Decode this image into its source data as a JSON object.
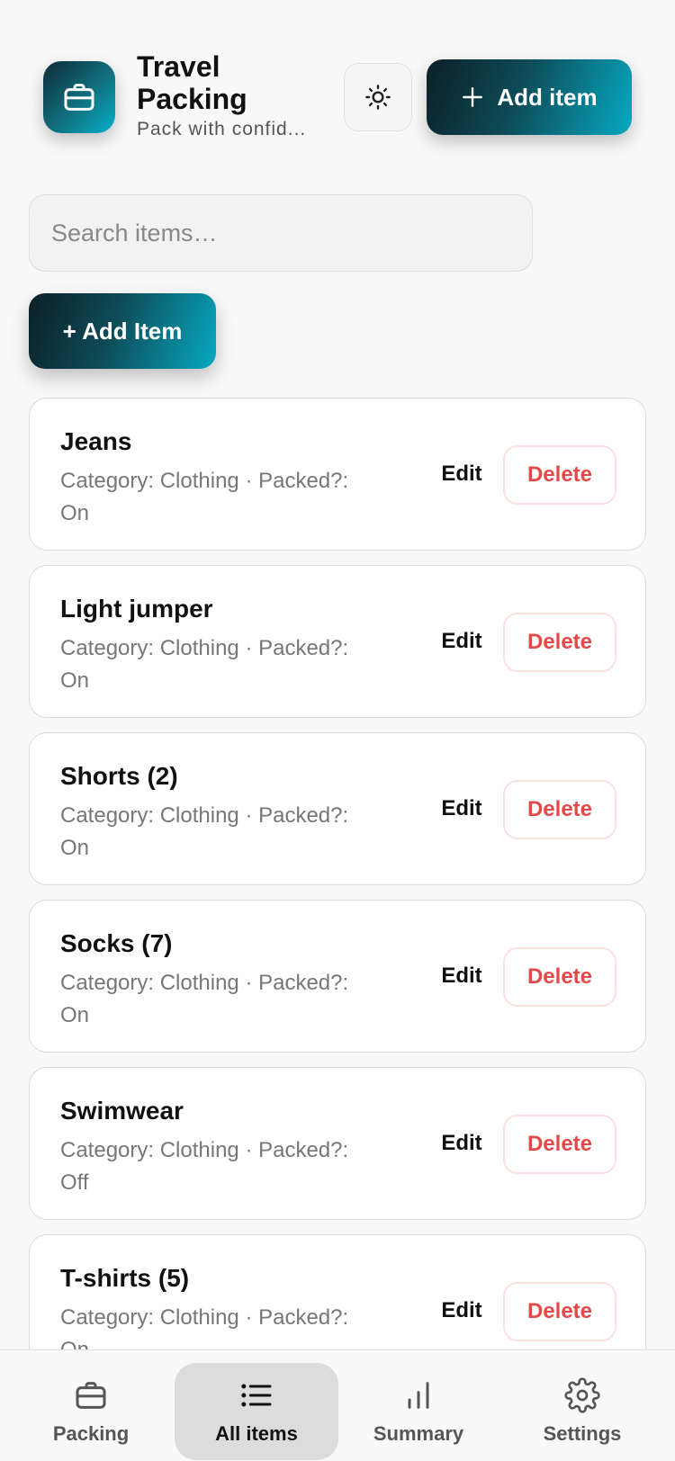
{
  "header": {
    "title": "Travel Packing",
    "subtitle": "Pack with confid...",
    "add_button_label": "Add item",
    "theme_icon": "sun-icon",
    "app_icon": "briefcase-icon"
  },
  "search": {
    "placeholder": "Search items…",
    "value": ""
  },
  "add_item_label": "+ Add Item",
  "items": [
    {
      "name": "Jeans",
      "meta": "Category: Clothing · Packed?: On",
      "edit": "Edit",
      "delete": "Delete"
    },
    {
      "name": "Light jumper",
      "meta": "Category: Clothing · Packed?: On",
      "edit": "Edit",
      "delete": "Delete"
    },
    {
      "name": "Shorts (2)",
      "meta": "Category: Clothing · Packed?: On",
      "edit": "Edit",
      "delete": "Delete"
    },
    {
      "name": "Socks (7)",
      "meta": "Category: Clothing · Packed?: On",
      "edit": "Edit",
      "delete": "Delete"
    },
    {
      "name": "Swimwear",
      "meta": "Category: Clothing · Packed?: Off",
      "edit": "Edit",
      "delete": "Delete"
    },
    {
      "name": "T-shirts (5)",
      "meta": "Category: Clothing · Packed?: On",
      "edit": "Edit",
      "delete": "Delete"
    }
  ],
  "nav": [
    {
      "label": "Packing",
      "icon": "briefcase-icon",
      "active": false
    },
    {
      "label": "All items",
      "icon": "list-icon",
      "active": true
    },
    {
      "label": "Summary",
      "icon": "bar-chart-icon",
      "active": false
    },
    {
      "label": "Settings",
      "icon": "gear-icon",
      "active": false
    }
  ],
  "colors": {
    "accent_dark": "#0c1f26",
    "accent_light": "#07a9c2",
    "delete_red": "#e54848"
  }
}
